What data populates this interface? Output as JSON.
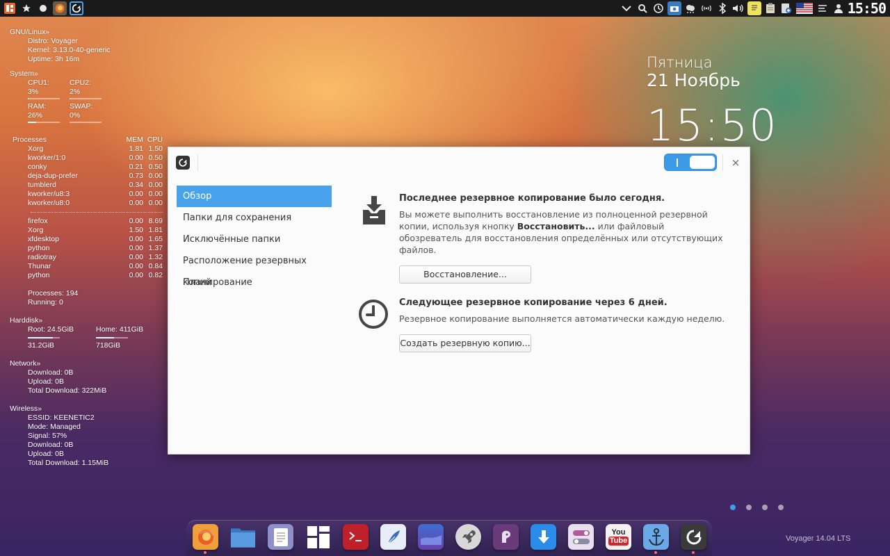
{
  "top_panel": {
    "left_icons": [
      "apps-menu-icon",
      "star-icon",
      "circle-icon",
      "firefox-icon",
      "backup-app-icon"
    ],
    "right_icons": [
      "chevron-down-icon",
      "search-icon",
      "history-icon",
      "camera-icon",
      "weather-icon",
      "wifi-icon",
      "bluetooth-icon",
      "volume-icon",
      "notes-icon",
      "clipboard-icon",
      "updates-icon",
      "us-flag-icon",
      "menu-lines-icon",
      "user-icon"
    ],
    "clock": "15:50"
  },
  "conky": {
    "gnu": {
      "title": "GNU/Linux»",
      "distro": "Distro: Voyager",
      "kernel": "Kernel: 3.13.0-40-generic",
      "uptime": "Uptime: 3h 16m"
    },
    "system": {
      "title": "System»",
      "cpu1": {
        "label": "CPU1: 3%",
        "level": 0.03
      },
      "cpu2": {
        "label": "CPU2: 2%",
        "level": 0.02
      },
      "ram": {
        "label": "RAM: 26%",
        "level": 0.26
      },
      "swap": {
        "label": "SWAP: 0%",
        "level": 0.0
      }
    },
    "processes": {
      "header": {
        "name": "Processes",
        "mem": "MEM",
        "cpu": "CPU"
      },
      "group1": [
        {
          "name": "Xorg",
          "mem": "1.81",
          "cpu": "1.50"
        },
        {
          "name": "kworker/1:0",
          "mem": "0.00",
          "cpu": "0.50"
        },
        {
          "name": "conky",
          "mem": "0.21",
          "cpu": "0.50"
        },
        {
          "name": "deja-dup-prefer",
          "mem": "0.73",
          "cpu": "0.00"
        },
        {
          "name": "tumblerd",
          "mem": "0.34",
          "cpu": "0.00"
        },
        {
          "name": "kworker/u8:3",
          "mem": "0.00",
          "cpu": "0.00"
        },
        {
          "name": "kworker/u8:0",
          "mem": "0.00",
          "cpu": "0.00"
        }
      ],
      "group2": [
        {
          "name": "firefox",
          "mem": "0.00",
          "cpu": "8.69"
        },
        {
          "name": "Xorg",
          "mem": "1.50",
          "cpu": "1.81"
        },
        {
          "name": "xfdesktop",
          "mem": "0.00",
          "cpu": "1.65"
        },
        {
          "name": "python",
          "mem": "0.00",
          "cpu": "1.37"
        },
        {
          "name": "radiotray",
          "mem": "0.00",
          "cpu": "1.32"
        },
        {
          "name": "Thunar",
          "mem": "0.00",
          "cpu": "0.84"
        },
        {
          "name": "python",
          "mem": "0.00",
          "cpu": "0.82"
        }
      ],
      "total": "Processes: 194",
      "running": "Running: 0"
    },
    "harddisk": {
      "title": "Harddisk»",
      "root": {
        "label": "Root: 24.5GiB",
        "size": "31.2GiB",
        "level": 0.78
      },
      "home": {
        "label": "Home: 411GiB",
        "size": "718GiB",
        "level": 0.57
      }
    },
    "network": {
      "title": "Network»",
      "download": "Download: 0B",
      "upload": "Upload: 0B",
      "total": "Total Download: 322MiB"
    },
    "wireless": {
      "title": "Wireless»",
      "essid": "ESSID: KEENETIC2",
      "mode": "Mode: Managed",
      "signal": "Signal: 57%",
      "download": "Download: 0B",
      "upload": "Upload: 0B",
      "total": "Total Download: 1.15MiB"
    }
  },
  "date_widget": {
    "day": "Пятница",
    "date": "21 Ноябрь",
    "time": "15:50"
  },
  "dialog": {
    "close_glyph": "×",
    "toggle_state": "on",
    "sidebar": [
      {
        "label": "Обзор",
        "active": true
      },
      {
        "label": "Папки для сохранения",
        "active": false
      },
      {
        "label": "Исключённые папки",
        "active": false
      },
      {
        "label": "Расположение резервных копий",
        "active": false
      },
      {
        "label": "Планирование",
        "active": false
      }
    ],
    "last_backup": {
      "title": "Последнее резервное копирование было сегодня.",
      "text_before": "Вы можете выполнить восстановление из полноценной резервной копии, используя кнопку ",
      "text_bold": "Восстановить...",
      "text_after": " или файловый обозреватель для восстановления определённых или отсутствующих файлов.",
      "button": "Восстановление..."
    },
    "next_backup": {
      "title": "Следующее резервное копирование через 6 дней.",
      "text": "Резервное копирование выполняется автоматически каждую неделю.",
      "button": "Создать резервную копию..."
    }
  },
  "workspace_dots": {
    "count": 4,
    "active": 0
  },
  "dock": {
    "items": [
      "firefox-icon",
      "files-icon",
      "text-editor-icon",
      "mosaic-icon",
      "terminal-icon",
      "feather-icon",
      "desktop-icon",
      "rocket-icon",
      "pidgin-icon",
      "download-icon",
      "settings-toggle-icon",
      "youtube-icon",
      "anchor-icon",
      "backup-icon"
    ],
    "youtube_top": "You",
    "youtube_bottom": "Tube"
  },
  "brand": "Voyager 14.04 LTS",
  "colors": {
    "accent": "#48a3ec",
    "panel": "#1a1a1a",
    "dialog_bg": "#fbfbfb"
  }
}
